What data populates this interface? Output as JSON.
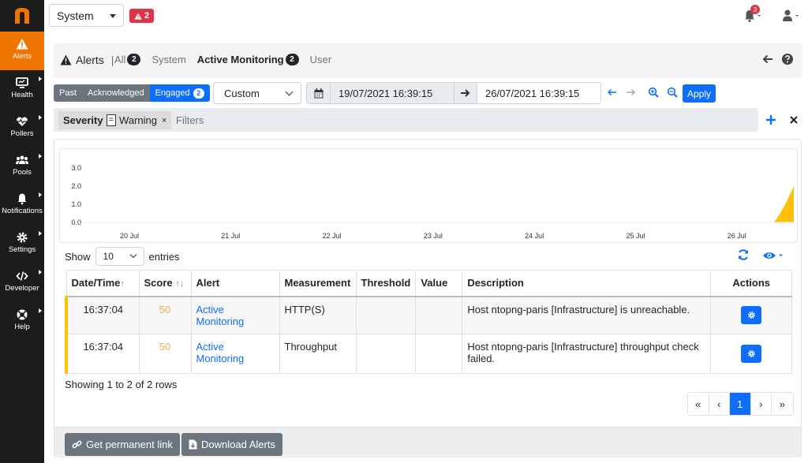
{
  "brand": {
    "logo_letter": "n",
    "accent": "#f07400"
  },
  "sidebar": {
    "items": [
      {
        "label": "Alerts",
        "icon": "warning-triangle-icon",
        "active": true
      },
      {
        "label": "Health",
        "icon": "monitor-icon"
      },
      {
        "label": "Pollers",
        "icon": "heartbeat-icon"
      },
      {
        "label": "Pools",
        "icon": "users-icon"
      },
      {
        "label": "Notifications",
        "icon": "bell-icon"
      },
      {
        "label": "Settings",
        "icon": "gear-icon"
      },
      {
        "label": "Developer",
        "icon": "code-icon"
      },
      {
        "label": "Help",
        "icon": "life-ring-icon"
      }
    ]
  },
  "topbar": {
    "interface_select": "System",
    "alert_badge_count": "2",
    "notifications_count": "3"
  },
  "header": {
    "title": "Alerts",
    "separator": "|",
    "tabs": [
      {
        "label": "All",
        "count": "2"
      },
      {
        "label": "System"
      },
      {
        "label": "Active Monitoring",
        "count": "2"
      },
      {
        "label": "User"
      }
    ]
  },
  "status_filter": {
    "past": "Past",
    "acknowledged": "Acknowledged",
    "engaged": "Engaged",
    "engaged_count": "2"
  },
  "range": {
    "preset": "Custom",
    "start": "19/07/2021 16:39:15",
    "end": "26/07/2021 16:39:15",
    "apply": "Apply"
  },
  "tag_filter": {
    "key": "Severity",
    "op": "=",
    "value": "Warning",
    "remove": "×",
    "placeholder": "Filters"
  },
  "chart_data": {
    "type": "area",
    "x_ticks": [
      "20 Jul",
      "21 Jul",
      "22 Jul",
      "23 Jul",
      "24 Jul",
      "25 Jul",
      "26 Jul"
    ],
    "y_ticks": [
      "0.0",
      "1.0",
      "2.0",
      "3.0"
    ],
    "ylim": [
      0,
      3
    ],
    "series": [
      {
        "values": [
          0,
          0,
          0,
          0,
          0,
          0,
          0,
          2.0
        ],
        "color": "#ffc107"
      }
    ]
  },
  "table": {
    "show_label": "Show",
    "entries_value": "10",
    "entries_label": "entries",
    "columns": [
      "Date/Time",
      "Score",
      "Alert",
      "Measurement",
      "Threshold",
      "Value",
      "Description",
      "Actions"
    ],
    "rows": [
      {
        "time": "16:37:04",
        "score": "50",
        "alert": "Active Monitoring",
        "measurement": "HTTP(S)",
        "threshold": "",
        "value": "",
        "description": "Host ntopng-paris [Infrastructure] is unreachable."
      },
      {
        "time": "16:37:04",
        "score": "50",
        "alert": "Active Monitoring",
        "measurement": "Throughput",
        "threshold": "",
        "value": "",
        "description": "Host ntopng-paris [Infrastructure] throughput check failed."
      }
    ],
    "showing": "Showing 1 to 2 of 2 rows",
    "pager": [
      "«",
      "‹",
      "1",
      "›",
      "»"
    ]
  },
  "footer": {
    "permalink": "Get permanent link",
    "download": "Download Alerts"
  }
}
